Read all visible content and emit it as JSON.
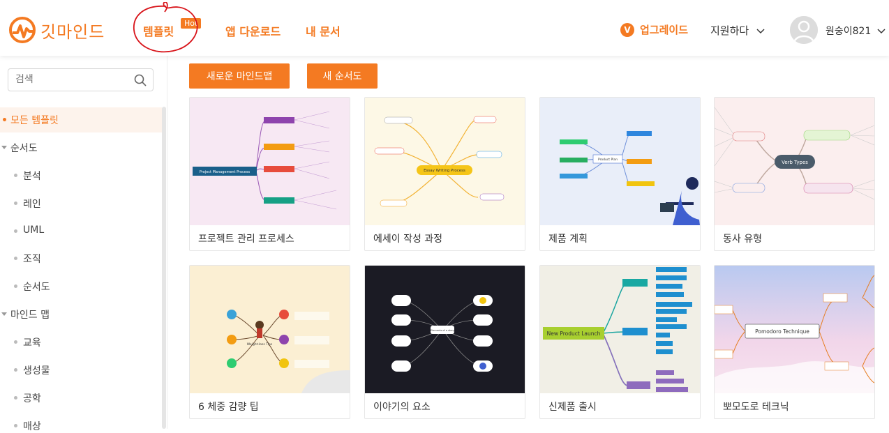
{
  "app": {
    "logo_text": "깃마인드",
    "brand_color": "#f47a22"
  },
  "nav": {
    "templates": "템플릿",
    "hot_badge": "Hot",
    "download": "앱 다운로드",
    "my_docs": "내 문서",
    "upgrade": "업그레이드",
    "support": "지원하다",
    "username": "원숭이821"
  },
  "sidebar": {
    "search_placeholder": "검색",
    "items": [
      {
        "label": "모든 템플릿",
        "active": true
      },
      {
        "label": "순서도",
        "group": true
      },
      {
        "label": "분석"
      },
      {
        "label": "레인"
      },
      {
        "label": "UML"
      },
      {
        "label": "조직"
      },
      {
        "label": "순서도"
      },
      {
        "label": "마인드 맵",
        "group": true
      },
      {
        "label": "교육"
      },
      {
        "label": "생성물"
      },
      {
        "label": "공학"
      },
      {
        "label": "매상"
      }
    ]
  },
  "actions": {
    "new_mindmap": "새로운 마인드맵",
    "new_flowchart": "새 순서도"
  },
  "templates": [
    {
      "title": "프로젝트 관리 프로세스",
      "root": "Project Management Process",
      "bg": "#f7e8f3"
    },
    {
      "title": "에세이 작성 과정",
      "root": "Essay Writing Process",
      "bg": "#fdf8e6"
    },
    {
      "title": "제품 계획",
      "root": "Product Plan",
      "bg": "#e9eef9"
    },
    {
      "title": "동사 유형",
      "root": "Verb Types",
      "bg": "#fbeeee"
    },
    {
      "title": "6 체중 감량 팁",
      "root": "Weight-loss Tips",
      "bg": "#fbefd3"
    },
    {
      "title": "이야기의 요소",
      "root": "Elements of a story",
      "bg": "#1b1b24"
    },
    {
      "title": "신제품 출시",
      "root": "New Product Launch",
      "bg": "#f1efe6"
    },
    {
      "title": "뽀모도로 테크닉",
      "root": "Pomodoro Technique",
      "bg": "#f2e6f0"
    }
  ]
}
